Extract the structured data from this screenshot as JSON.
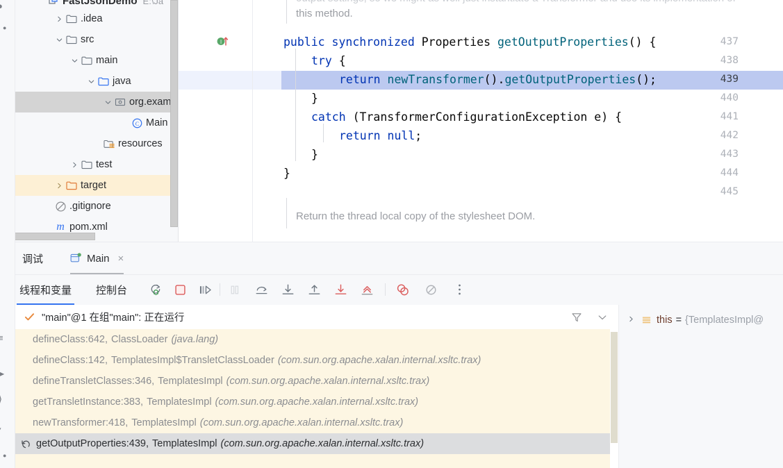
{
  "project_tree": {
    "name": "project-tree",
    "root": {
      "label": "FastJsonDemo",
      "path_hint": "E:\\Ja",
      "icon": "module-icon"
    },
    "items": [
      {
        "label": ".idea",
        "icon": "folder-icon",
        "indent": 1,
        "arrow": "collapsed",
        "state": "normal"
      },
      {
        "label": "src",
        "icon": "folder-icon",
        "indent": 1,
        "arrow": "expanded",
        "state": "normal"
      },
      {
        "label": "main",
        "icon": "folder-icon",
        "indent": 2,
        "arrow": "expanded",
        "state": "normal"
      },
      {
        "label": "java",
        "icon": "source-folder-icon",
        "indent": 3,
        "arrow": "expanded",
        "state": "normal"
      },
      {
        "label": "org.example",
        "icon": "package-icon",
        "indent": 4,
        "arrow": "expanded",
        "state": "selected-gray"
      },
      {
        "label": "Main",
        "icon": "java-class-icon",
        "indent": 5,
        "arrow": "none",
        "state": "normal"
      },
      {
        "label": "resources",
        "icon": "resource-folder-icon",
        "indent": 3,
        "arrow": "none",
        "state": "normal"
      },
      {
        "label": "test",
        "icon": "folder-icon",
        "indent": 2,
        "arrow": "collapsed",
        "state": "normal"
      },
      {
        "label": "target",
        "icon": "target-folder-icon",
        "indent": 1,
        "arrow": "collapsed",
        "state": "selected-amber"
      },
      {
        "label": ".gitignore",
        "icon": "gitignore-icon",
        "indent": 1,
        "arrow": "none",
        "state": "normal"
      },
      {
        "label": "pom.xml",
        "icon": "maven-icon",
        "indent": 1,
        "arrow": "none",
        "state": "normal"
      }
    ]
  },
  "editor": {
    "name": "code-editor",
    "file": "TemplatesImpl",
    "current_line": 439,
    "line_numbers": [
      "437",
      "438",
      "439",
      "440",
      "441",
      "442",
      "443",
      "444",
      "445"
    ],
    "gutter_marks": [
      {
        "line": "437",
        "icon": "implementing-method-icon",
        "color": "#59a869"
      }
    ],
    "doc_top": {
      "line1": "output settings, so we might as well just instantiate a Transformer and use its implementation of",
      "line2": "this method."
    },
    "code": [
      {
        "text": "public synchronized Properties getOutputProperties() {",
        "indent": 0
      },
      {
        "text": "try {",
        "indent": 1
      },
      {
        "text": "return newTransformer().getOutputProperties();",
        "indent": 2,
        "highlight": true
      },
      {
        "text": "}",
        "indent": 1
      },
      {
        "text": "catch (TransformerConfigurationException e) {",
        "indent": 1
      },
      {
        "text": "return null;",
        "indent": 2
      },
      {
        "text": "}",
        "indent": 1
      },
      {
        "text": "}",
        "indent": 0
      }
    ],
    "doc_bottom": "Return the thread local copy of the stylesheet DOM."
  },
  "debug": {
    "window_tabs": [
      {
        "label": "调试",
        "name": "tab-debug",
        "active": false,
        "icon": "none"
      },
      {
        "label": "Main",
        "name": "tab-main-config",
        "active": true,
        "icon": "run-config-icon",
        "closable": true,
        "close_glyph": "×"
      }
    ],
    "content_tabs": [
      {
        "label": "线程和变量",
        "name": "tab-threads-and-variables",
        "active": true
      },
      {
        "label": "控制台",
        "name": "tab-console",
        "active": false
      }
    ],
    "toolbar_buttons": [
      {
        "name": "rerun-debug-button",
        "icon": "rerun-icon",
        "color": "#6e7781",
        "enabled": true
      },
      {
        "name": "stop-button",
        "icon": "stop-square-icon",
        "color": "#db5c5c",
        "enabled": true
      },
      {
        "name": "resume-program-button",
        "icon": "resume-icon",
        "color": "#6e7781",
        "enabled": true
      },
      {
        "name": "pause-program-button",
        "icon": "pause-icon",
        "color": "#b4b8bf",
        "enabled": false
      },
      {
        "name": "step-over-button",
        "icon": "step-over-icon",
        "color": "#6e7781",
        "enabled": true
      },
      {
        "name": "step-into-button",
        "icon": "step-into-icon",
        "color": "#6e7781",
        "enabled": true
      },
      {
        "name": "step-out-button",
        "icon": "step-out-icon",
        "color": "#6e7781",
        "enabled": true
      },
      {
        "name": "force-step-into-button",
        "icon": "force-step-into-icon",
        "color": "#db5c5c",
        "enabled": true
      },
      {
        "name": "run-to-cursor-button",
        "icon": "run-to-cursor-icon",
        "color": "#db5c5c",
        "enabled": true
      },
      {
        "name": "view-breakpoints-button",
        "icon": "breakpoints-icon",
        "color": "#db5c5c",
        "enabled": true
      },
      {
        "name": "mute-breakpoints-button",
        "icon": "mute-breakpoints-icon",
        "color": "#b0b3b8",
        "enabled": true
      },
      {
        "name": "more-options-button",
        "icon": "more-vertical-icon",
        "color": "#6e7781",
        "enabled": true
      }
    ],
    "thread": {
      "status_icon": "running-check-icon",
      "status_color": "#e8893c",
      "label": "\"main\"@1 在组\"main\": 正在运行",
      "filter_icon": "filter-icon",
      "expand_icon": "chevron-down-icon"
    },
    "frames": [
      {
        "method": "defineClass:642,",
        "clazz": "ClassLoader",
        "pkg": "(java.lang)",
        "current": false
      },
      {
        "method": "defineClass:142,",
        "clazz": "TemplatesImpl$TransletClassLoader",
        "pkg": "(com.sun.org.apache.xalan.internal.xsltc.trax)",
        "current": false
      },
      {
        "method": "defineTransletClasses:346,",
        "clazz": "TemplatesImpl",
        "pkg": "(com.sun.org.apache.xalan.internal.xsltc.trax)",
        "current": false
      },
      {
        "method": "getTransletInstance:383,",
        "clazz": "TemplatesImpl",
        "pkg": "(com.sun.org.apache.xalan.internal.xsltc.trax)",
        "current": false
      },
      {
        "method": "newTransformer:418,",
        "clazz": "TemplatesImpl",
        "pkg": "(com.sun.org.apache.xalan.internal.xsltc.trax)",
        "current": false
      },
      {
        "method": "getOutputProperties:439,",
        "clazz": "TemplatesImpl",
        "pkg": "(com.sun.org.apache.xalan.internal.xsltc.trax)",
        "current": true,
        "icon": "current-frame-icon"
      }
    ],
    "variables": [
      {
        "expander": "›",
        "icon": "object-value-icon",
        "name": "this",
        "eq": "=",
        "value": "{TemplatesImpl@"
      }
    ]
  },
  "colors": {
    "accent_blue": "#3574f0",
    "selection_blue": "#bcc9f0",
    "line_hl_blue": "#eef2fd",
    "keyword_blue": "#0033b3",
    "method_teal": "#00627a",
    "frames_bg": "#fdf6e3",
    "amber_row": "#fdf0d5",
    "gray_row": "#d4d4d4",
    "panel_bg": "#f7f8fa"
  }
}
